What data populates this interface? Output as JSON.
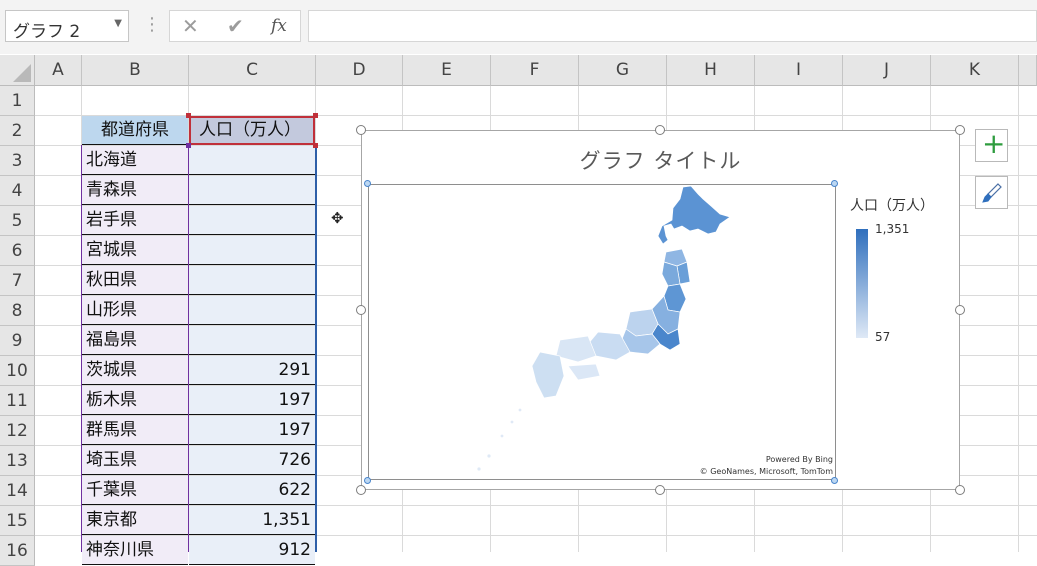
{
  "formula_bar": {
    "name_box": "グラフ 2",
    "cancel_glyph": "✕",
    "enter_glyph": "✔",
    "function_glyph": "fx",
    "formula": ""
  },
  "columns": [
    "A",
    "B",
    "C",
    "D",
    "E",
    "F",
    "G",
    "H",
    "I",
    "J",
    "K"
  ],
  "rows": [
    "1",
    "2",
    "3",
    "4",
    "5",
    "6",
    "7",
    "8",
    "9",
    "10",
    "11",
    "12",
    "13",
    "14",
    "15",
    "16"
  ],
  "table": {
    "header_b": "都道府県",
    "header_c": "人口（万人）",
    "rows": [
      {
        "pref": "北海道",
        "pop": ""
      },
      {
        "pref": "青森県",
        "pop": ""
      },
      {
        "pref": "岩手県",
        "pop": ""
      },
      {
        "pref": "宮城県",
        "pop": ""
      },
      {
        "pref": "秋田県",
        "pop": ""
      },
      {
        "pref": "山形県",
        "pop": ""
      },
      {
        "pref": "福島県",
        "pop": ""
      },
      {
        "pref": "茨城県",
        "pop": "291"
      },
      {
        "pref": "栃木県",
        "pop": "197"
      },
      {
        "pref": "群馬県",
        "pop": "197"
      },
      {
        "pref": "埼玉県",
        "pop": "726"
      },
      {
        "pref": "千葉県",
        "pop": "622"
      },
      {
        "pref": "東京都",
        "pop": "1,351"
      },
      {
        "pref": "神奈川県",
        "pop": "912"
      }
    ]
  },
  "chart": {
    "title": "グラフ タイトル",
    "legend_title": "人口（万人）",
    "legend_max": "1,351",
    "legend_min": "57",
    "attribution_line1": "Powered By Bing",
    "attribution_line2": "© GeoNames, Microsoft, TomTom",
    "map_color_high": "#5b93d3",
    "map_color_low": "#dfe9f6"
  },
  "chart_buttons": {
    "add_element_glyph": "+"
  },
  "colors": {
    "header_b_fill": "#bdd7ee",
    "header_c_fill": "#c3c9dd",
    "col_b_fill": "#f1ecf7",
    "col_c_fill": "#e9eff8",
    "range_b_border": "#7030a0",
    "range_c_border": "#2e5fa8",
    "header_c_border": "#c0303a"
  }
}
